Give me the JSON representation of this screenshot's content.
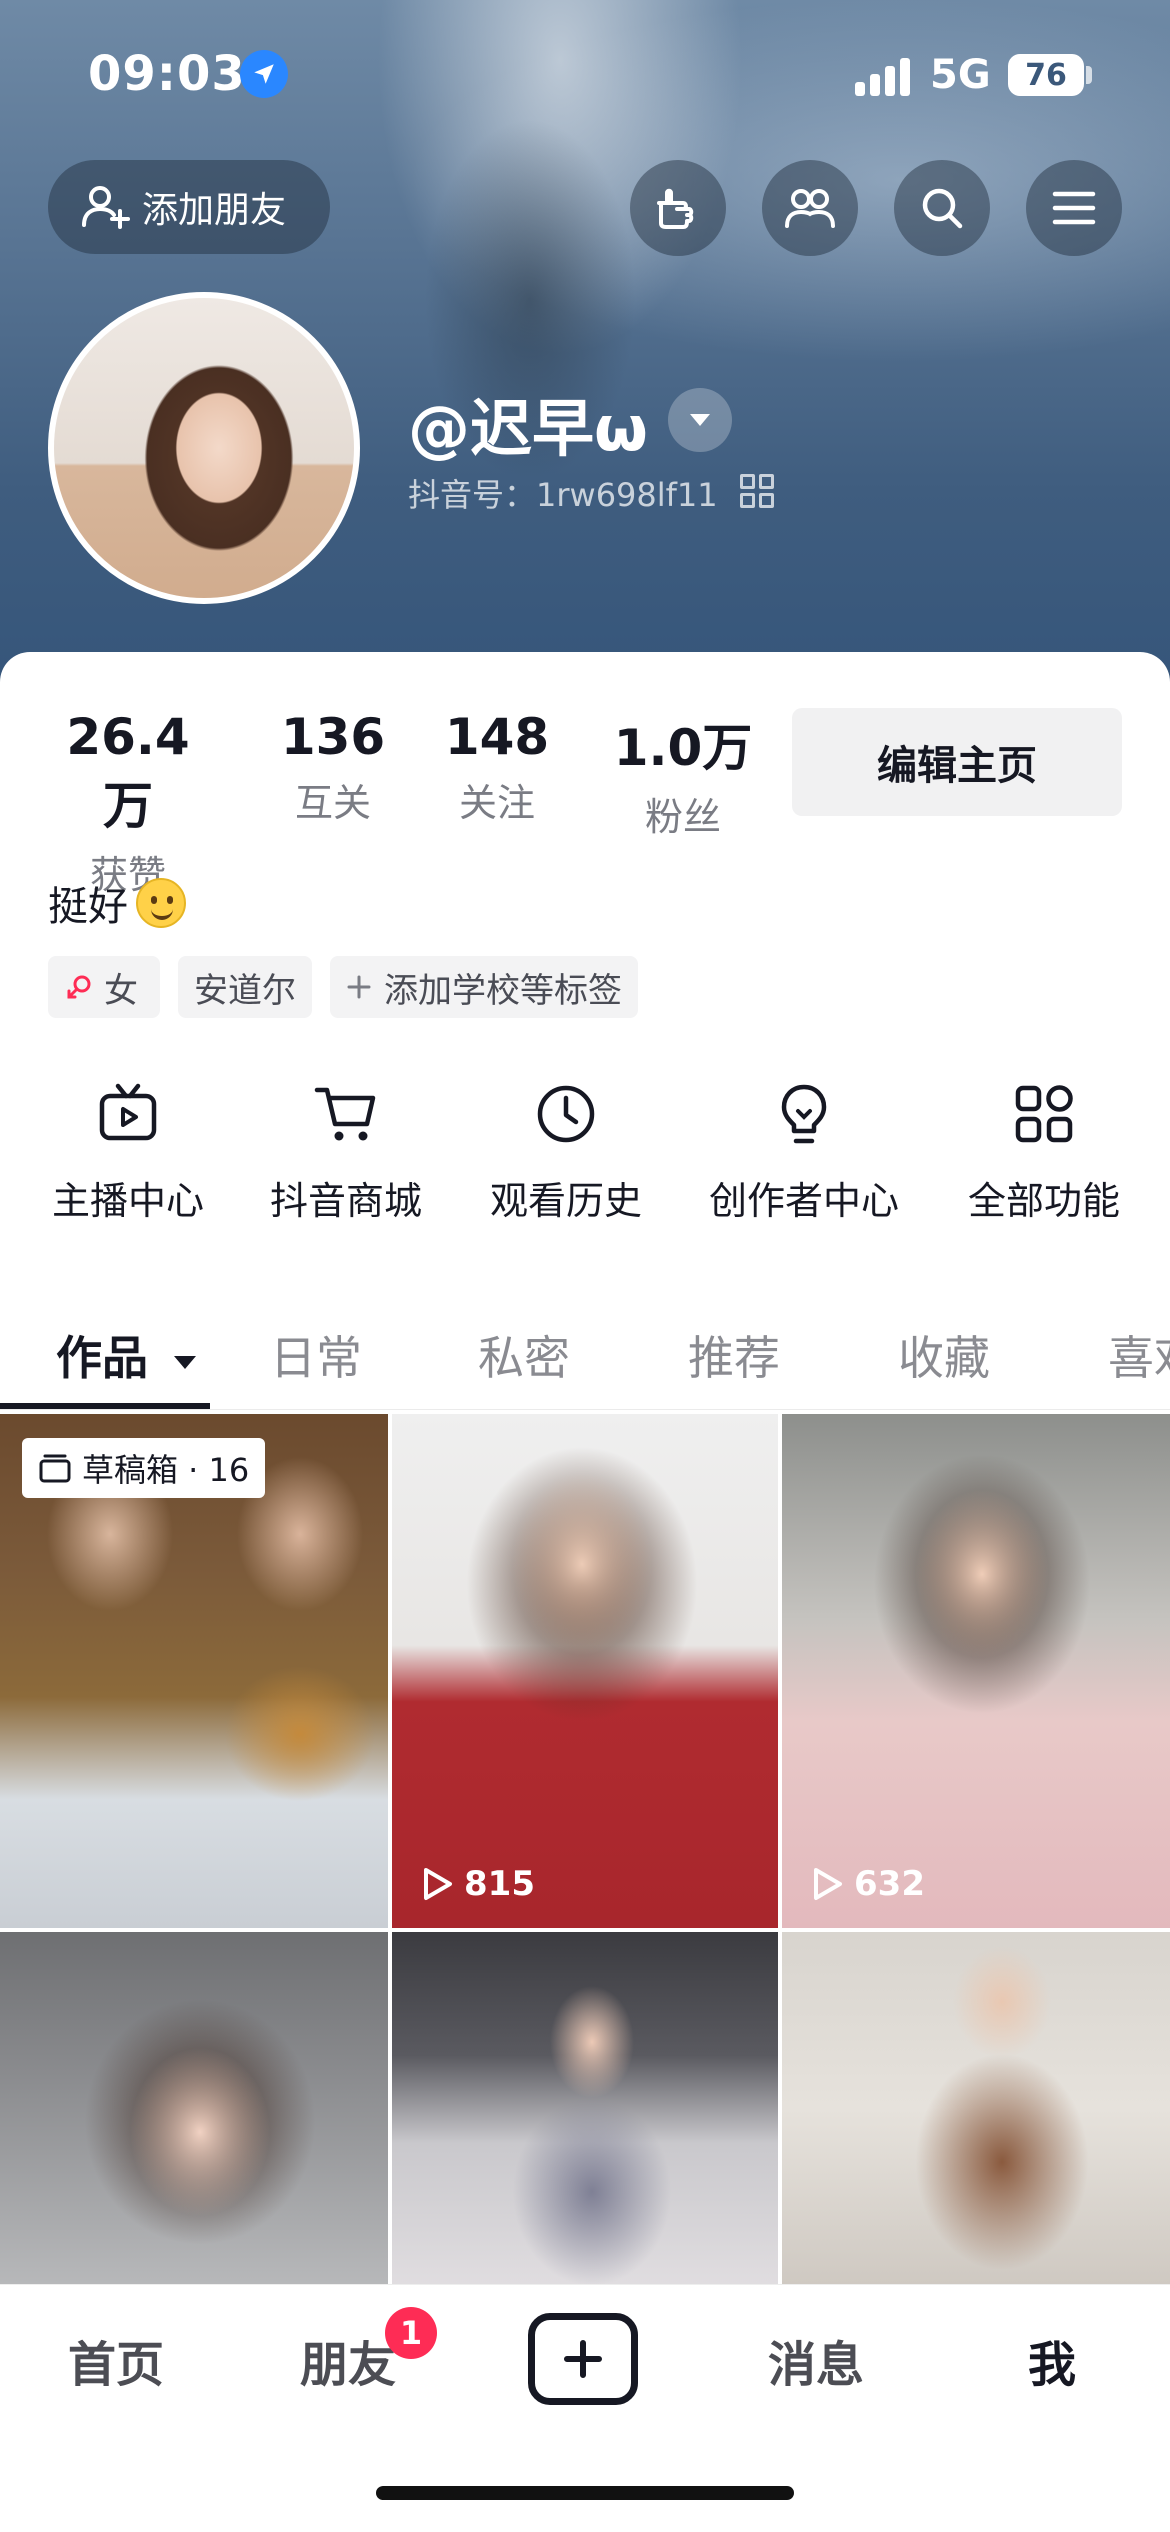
{
  "status_bar": {
    "time": "09:03",
    "network": "5G",
    "battery": "76"
  },
  "header": {
    "add_friend_label": "添加朋友",
    "username": "@迟早ω",
    "douyin_id": "抖音号：1rw698lf11"
  },
  "stats": [
    {
      "value": "26.4万",
      "label": "获赞"
    },
    {
      "value": "136",
      "label": "互关"
    },
    {
      "value": "148",
      "label": "关注"
    },
    {
      "value": "1.0万",
      "label": "粉丝"
    }
  ],
  "edit_profile_label": "编辑主页",
  "bio": "挺好",
  "tags": {
    "gender": "女",
    "location": "安道尔",
    "add_tag": "添加学校等标签"
  },
  "functions": [
    {
      "label": "主播中心",
      "icon": "tv-icon"
    },
    {
      "label": "抖音商城",
      "icon": "cart-icon"
    },
    {
      "label": "观看历史",
      "icon": "clock-icon"
    },
    {
      "label": "创作者中心",
      "icon": "lightbulb-icon"
    },
    {
      "label": "全部功能",
      "icon": "grid-icon"
    }
  ],
  "tabs": [
    "作品",
    "日常",
    "私密",
    "推荐",
    "收藏",
    "喜欢"
  ],
  "grid": {
    "draft_label": "草稿箱 · 16",
    "videos": [
      {
        "plays": ""
      },
      {
        "plays": "815"
      },
      {
        "plays": "632"
      },
      {
        "plays": ""
      },
      {
        "plays": ""
      },
      {
        "plays": ""
      }
    ]
  },
  "bottom_nav": {
    "home": "首页",
    "friends": "朋友",
    "friends_badge": "1",
    "messages": "消息",
    "me": "我"
  },
  "colors": {
    "accent": "#fe2c55",
    "location_blue": "#2a87ff"
  }
}
